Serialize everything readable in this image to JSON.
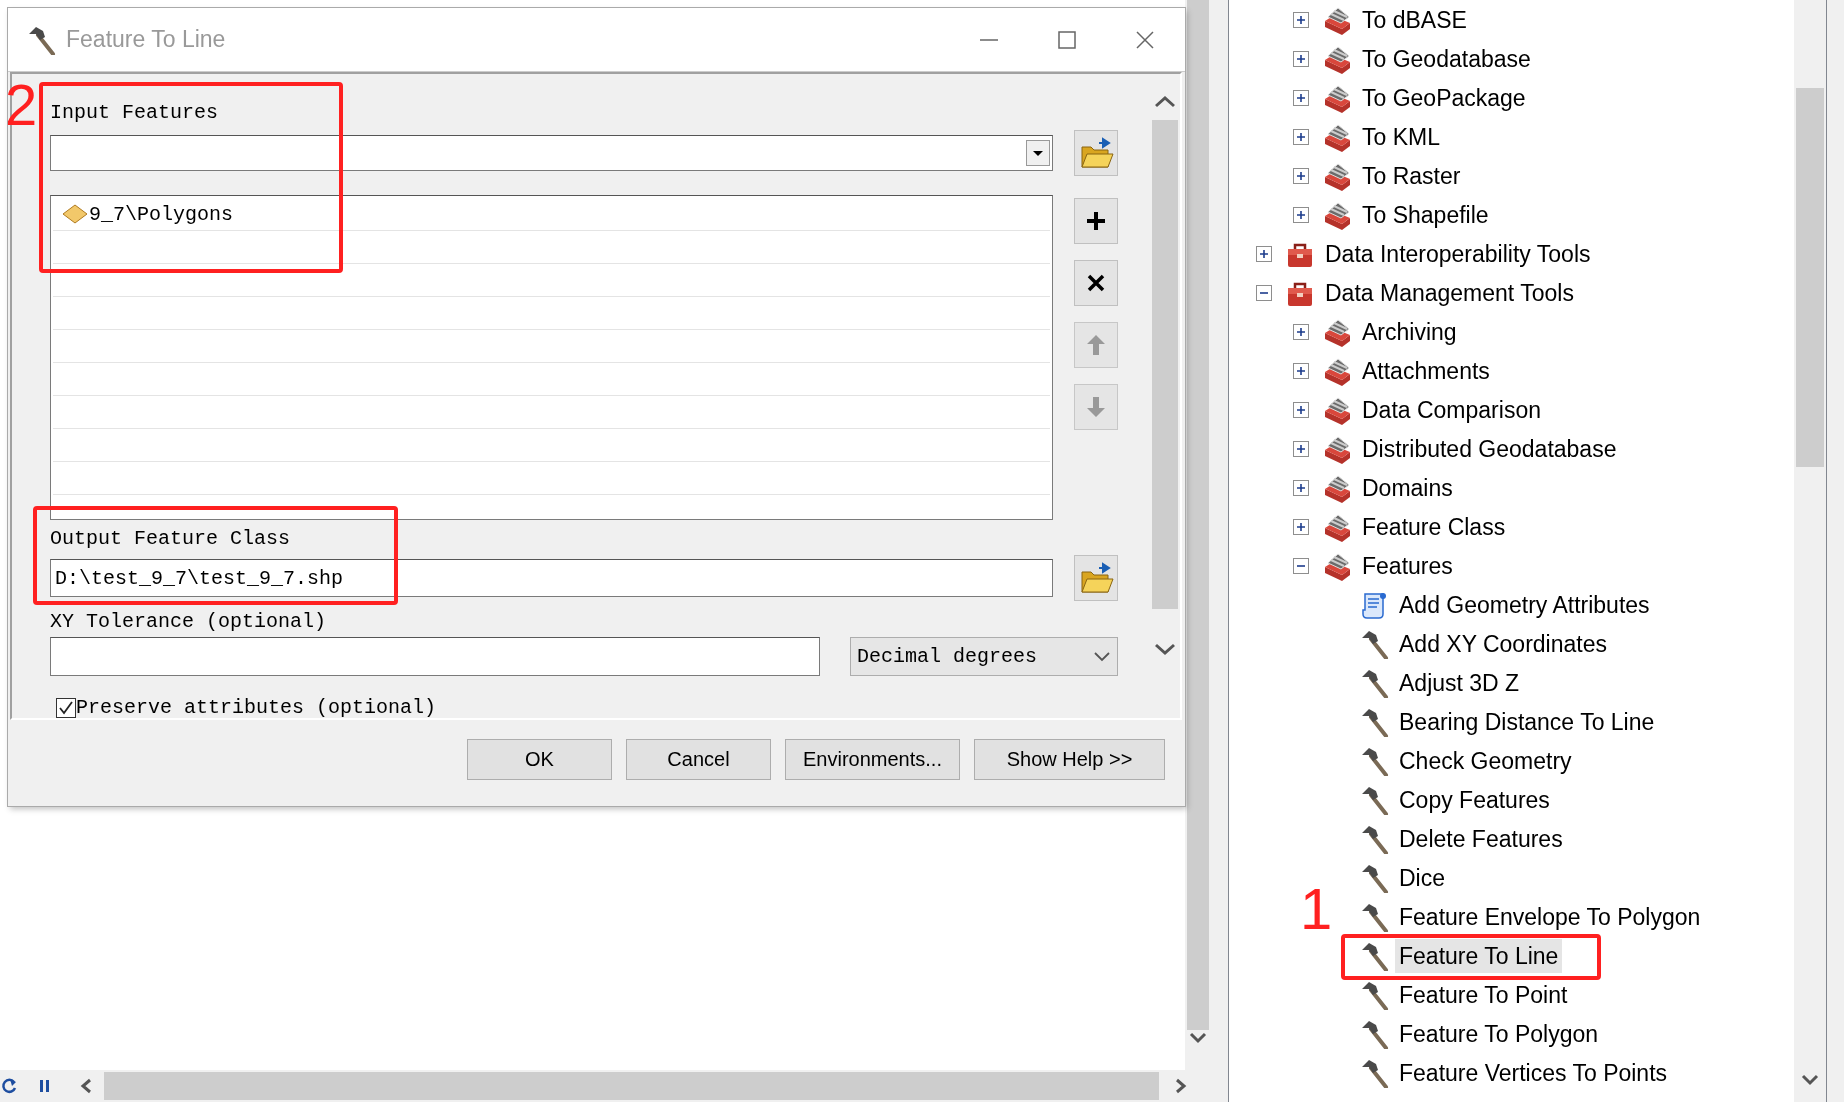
{
  "dialog": {
    "title": "Feature To Line",
    "input_features": {
      "label": "Input Features",
      "items": [
        {
          "name": "9_7\\Polygons"
        }
      ]
    },
    "side_buttons": [
      {
        "kind": "add",
        "disabled": false
      },
      {
        "kind": "remove",
        "disabled": false
      },
      {
        "kind": "up",
        "disabled": true
      },
      {
        "kind": "down",
        "disabled": true
      }
    ],
    "output_feature_class": {
      "label": "Output Feature Class",
      "value": "D:\\test_9_7\\test_9_7.shp"
    },
    "xy_tolerance": {
      "label": "XY Tolerance (optional)",
      "unit": "Decimal degrees"
    },
    "preserve_attributes": {
      "label": "Preserve attributes (optional)",
      "checked": true
    },
    "buttons": [
      "OK",
      "Cancel",
      "Environments...",
      "Show Help >>"
    ]
  },
  "tree": {
    "continued_items": [
      {
        "kind": "toolset",
        "label": "To dBASE",
        "expanded": false,
        "selected": false
      },
      {
        "kind": "toolset",
        "label": "To Geodatabase",
        "expanded": false,
        "selected": false
      },
      {
        "kind": "toolset",
        "label": "To GeoPackage",
        "expanded": false,
        "selected": false
      },
      {
        "kind": "toolset",
        "label": "To KML",
        "expanded": false,
        "selected": false
      },
      {
        "kind": "toolset",
        "label": "To Raster",
        "expanded": false,
        "selected": false
      },
      {
        "kind": "toolset",
        "label": "To Shapefile",
        "expanded": false,
        "selected": false
      }
    ],
    "items": [
      {
        "kind": "toolbox",
        "label": "Data Interoperability Tools",
        "expanded": false,
        "selected": false
      },
      {
        "kind": "toolbox",
        "label": "Data Management Tools",
        "expanded": true,
        "selected": false,
        "children": [
          {
            "kind": "toolset",
            "label": "Archiving",
            "expanded": false,
            "selected": false
          },
          {
            "kind": "toolset",
            "label": "Attachments",
            "expanded": false,
            "selected": false
          },
          {
            "kind": "toolset",
            "label": "Data Comparison",
            "expanded": false,
            "selected": false
          },
          {
            "kind": "toolset",
            "label": "Distributed Geodatabase",
            "expanded": false,
            "selected": false
          },
          {
            "kind": "toolset",
            "label": "Domains",
            "expanded": false,
            "selected": false
          },
          {
            "kind": "toolset",
            "label": "Feature Class",
            "expanded": false,
            "selected": false
          },
          {
            "kind": "toolset",
            "label": "Features",
            "expanded": true,
            "selected": false,
            "children": [
              {
                "kind": "script",
                "label": "Add Geometry Attributes",
                "selected": false
              },
              {
                "kind": "tool",
                "label": "Add XY Coordinates",
                "selected": false
              },
              {
                "kind": "tool",
                "label": "Adjust 3D Z",
                "selected": false
              },
              {
                "kind": "tool",
                "label": "Bearing Distance To Line",
                "selected": false
              },
              {
                "kind": "tool",
                "label": "Check Geometry",
                "selected": false
              },
              {
                "kind": "tool",
                "label": "Copy Features",
                "selected": false
              },
              {
                "kind": "tool",
                "label": "Delete Features",
                "selected": false
              },
              {
                "kind": "tool",
                "label": "Dice",
                "selected": false
              },
              {
                "kind": "tool",
                "label": "Feature Envelope To Polygon",
                "selected": false
              },
              {
                "kind": "tool",
                "label": "Feature To Line",
                "selected": true
              },
              {
                "kind": "tool",
                "label": "Feature To Point",
                "selected": false
              },
              {
                "kind": "tool",
                "label": "Feature To Polygon",
                "selected": false
              },
              {
                "kind": "tool",
                "label": "Feature Vertices To Points",
                "selected": false
              }
            ]
          }
        ]
      }
    ]
  },
  "annotations": [
    {
      "label": "2"
    },
    {
      "label": "1"
    }
  ]
}
